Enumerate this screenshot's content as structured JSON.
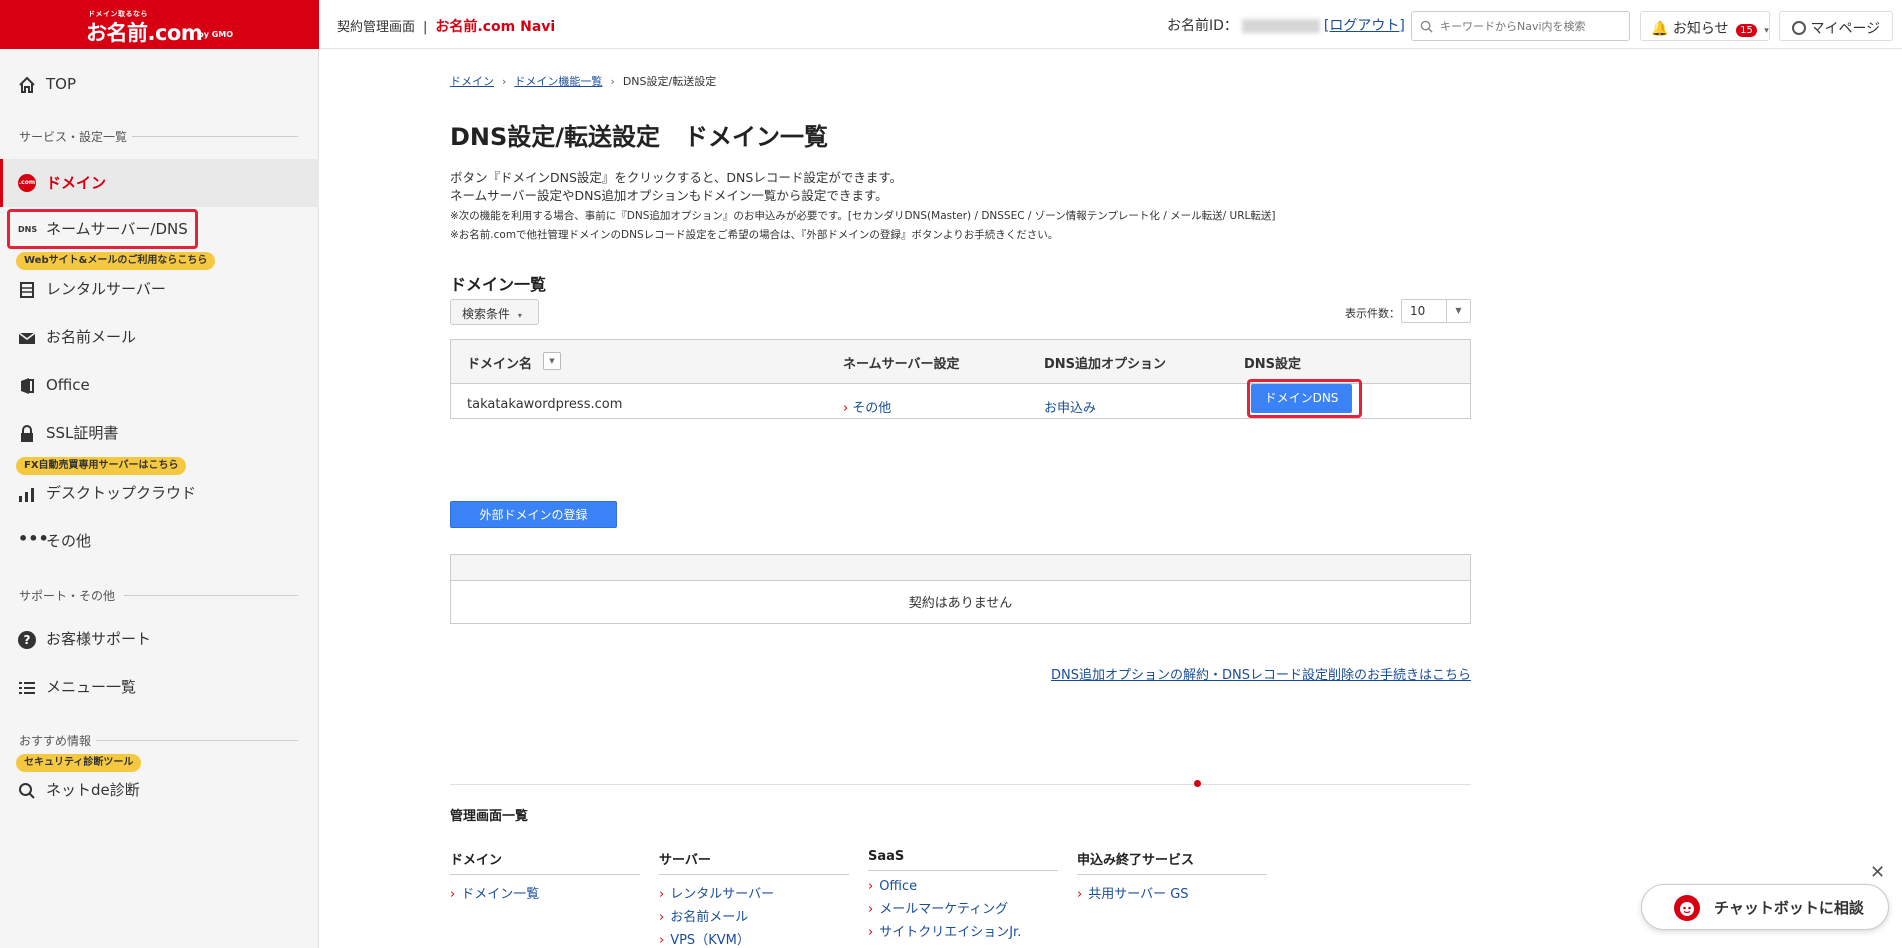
{
  "header": {
    "logo_small": "ドメイン取るなら",
    "logo_main": "お名前.com",
    "logo_gmo": "by GMO",
    "breadcrumb_label": "契約管理画面",
    "separator": "|",
    "navi_title": "お名前.com Navi",
    "id_label": "お名前ID：",
    "logout_label": "[ログアウト]",
    "search_placeholder": "キーワードからNavi内を検索",
    "notice_label": "お知らせ",
    "notice_count": "15",
    "mypage_label": "マイページ"
  },
  "sidebar": {
    "top": "TOP",
    "section_services": "サービス・設定一覧",
    "domain": "ドメイン",
    "nameserver": "ネームサーバー/DNS",
    "pill_web": "Webサイト&メールのご利用ならこちら",
    "rental": "レンタルサーバー",
    "mail": "お名前メール",
    "office": "Office",
    "ssl": "SSL証明書",
    "pill_fx": "FX自動売買専用サーバーはこちら",
    "desktop": "デスクトップクラウド",
    "other": "その他",
    "section_support": "サポート・その他",
    "support": "お客様サポート",
    "menu": "メニュー一覧",
    "section_reco": "おすすめ情報",
    "pill_security": "セキュリティ診断ツール",
    "diagnosis": "ネットde診断"
  },
  "main": {
    "breadcrumb": [
      "ドメイン",
      "ドメイン機能一覧",
      "DNS設定/転送設定"
    ],
    "title": "DNS設定/転送設定　ドメイン一覧",
    "desc1": "ボタン『ドメインDNS設定』をクリックすると、DNSレコード設定ができます。",
    "desc2": "ネームサーバー設定やDNS追加オプションもドメイン一覧から設定できます。",
    "desc3": "※次の機能を利用する場合、事前に『DNS追加オプション』のお申込みが必要です。[セカンダリDNS(Master) / DNSSEC / ゾーン情報テンプレート化 / メール転送/ URL転送]",
    "desc4": "※お名前.comで他社管理ドメインのDNSレコード設定をご希望の場合は、『外部ドメインの登録』ボタンよりお手続きください。",
    "list_title": "ドメイン一覧",
    "filter_label": "検索条件",
    "per_page_label": "表示件数：",
    "per_page_value": "10",
    "table": {
      "headers": [
        "ドメイン名",
        "ネームサーバー設定",
        "DNS追加オプション",
        "DNS設定"
      ],
      "row": {
        "domain": "takatakawordpress.com",
        "nameserver": "その他",
        "option": "お申込み",
        "dns_button": "ドメインDNS"
      }
    },
    "external_button": "外部ドメインの登録",
    "empty_text": "契約はありません",
    "cancel_link": "DNS追加オプションの解約・DNSレコード設定削除のお手続きはこちら"
  },
  "footer": {
    "title": "管理画面一覧",
    "columns": [
      {
        "heading": "ドメイン",
        "items": [
          "ドメイン一覧"
        ]
      },
      {
        "heading": "サーバー",
        "items": [
          "レンタルサーバー",
          "お名前メール",
          "VPS（KVM）"
        ]
      },
      {
        "heading": "SaaS",
        "items": [
          "Office",
          "メールマーケティング",
          "サイトクリエイションJr."
        ]
      },
      {
        "heading": "申込み終了サービス",
        "items": [
          "共用サーバー GS"
        ]
      }
    ]
  },
  "chatbot": {
    "label": "チャットボットに相談",
    "close": "✕"
  },
  "colors": {
    "brand_red": "#d60012",
    "accent_blue": "#3b82f6",
    "link_blue": "#1a4d99",
    "highlight_red": "#e6213a",
    "pill_yellow": "#f5c842"
  }
}
